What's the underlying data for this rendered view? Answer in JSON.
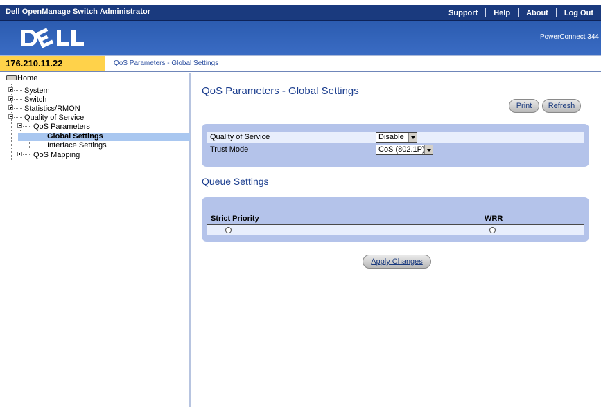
{
  "app_title": "Dell OpenManage Switch Administrator",
  "top_nav": [
    "Support",
    "Help",
    "About",
    "Log Out"
  ],
  "banner": {
    "logo_text": "D❤LL",
    "product": "PowerConnect 344"
  },
  "address_bar": {
    "ip": "176.210.11.22",
    "breadcrumb": "QoS Parameters - Global Settings"
  },
  "tree": {
    "home": "Home",
    "system": "System",
    "switch": "Switch",
    "statistics": "Statistics/RMON",
    "qos": "Quality of Service",
    "qos_params": "QoS Parameters",
    "global_settings": "Global Settings",
    "interface_settings": "Interface Settings",
    "qos_mapping": "QoS Mapping"
  },
  "page": {
    "title": "QoS Parameters - Global Settings",
    "print_label": "Print",
    "refresh_label": "Refresh",
    "fields": {
      "qos_label": "Quality of Service",
      "qos_value": "Disable",
      "trust_label": "Trust Mode",
      "trust_value": "CoS (802.1P)"
    },
    "queue_section_title": "Queue Settings",
    "queue_columns": {
      "strict": "Strict Priority",
      "wrr": "WRR"
    },
    "apply_label": "Apply Changes"
  },
  "colors": {
    "title_bar": "#1a3a7e",
    "banner": "#3a6cc4",
    "ip_cell": "#ffd24a",
    "panel": "#b4c3ea",
    "selected_node": "#a9c7f0"
  }
}
